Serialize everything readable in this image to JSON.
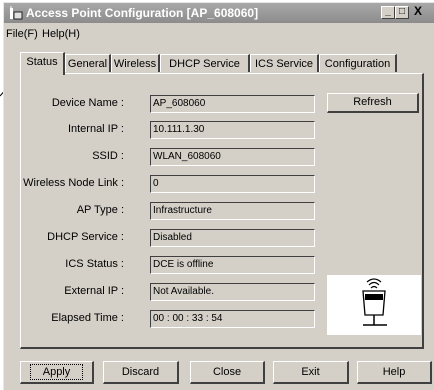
{
  "window": {
    "title": "Access Point Configuration [AP_608060]",
    "controls": [
      "_",
      "□",
      "X"
    ]
  },
  "menu": [
    {
      "label": "File(F)"
    },
    {
      "label": "Help(H)"
    }
  ],
  "tabs": [
    {
      "label": "Status",
      "active": true
    },
    {
      "label": "General"
    },
    {
      "label": "Wireless"
    },
    {
      "label": "DHCP Service"
    },
    {
      "label": "ICS Service"
    },
    {
      "label": "Configuration"
    }
  ],
  "status": {
    "fields": [
      {
        "label": "Device Name :",
        "value": "AP_608060"
      },
      {
        "label": "Internal IP :",
        "value": "10.111.1.30"
      },
      {
        "label": "SSID :",
        "value": "WLAN_608060"
      },
      {
        "label": "Wireless Node Link :",
        "value": "0"
      },
      {
        "label": "AP Type :",
        "value": "Infrastructure"
      },
      {
        "label": "DHCP Service :",
        "value": "Disabled"
      },
      {
        "label": "ICS Status :",
        "value": "DCE is offline"
      },
      {
        "label": "External IP :",
        "value": "Not Available."
      },
      {
        "label": "Elapsed Time :",
        "value": "00 : 00 : 33 : 54"
      }
    ],
    "refresh_label": "Refresh"
  },
  "buttons": {
    "apply": "Apply",
    "discard": "Discard",
    "close": "Close",
    "exit": "Exit",
    "help": "Help"
  }
}
